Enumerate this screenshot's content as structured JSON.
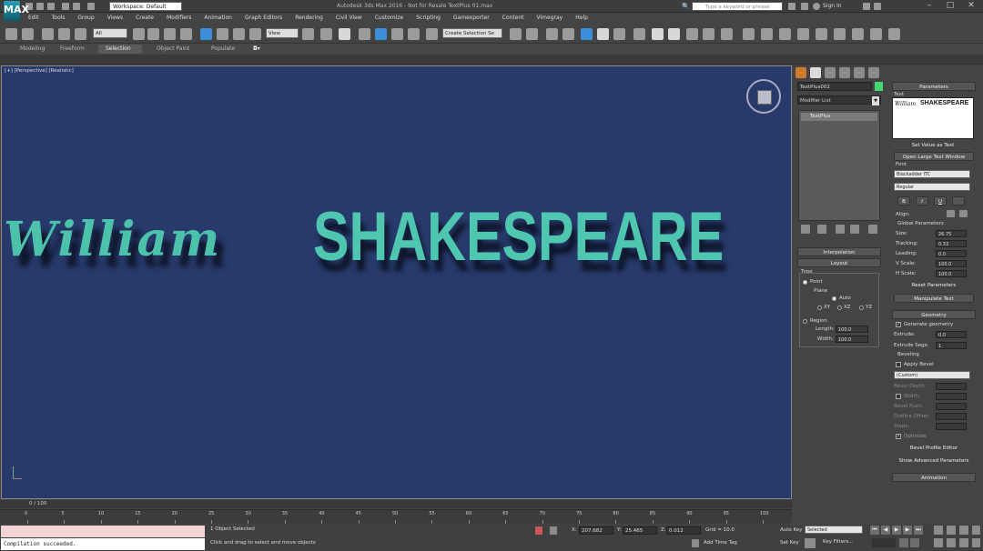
{
  "app": {
    "logo": "MAX",
    "workspace": "Workspace: Default",
    "window_title": "Autodesk 3ds Max 2016 - Not for Resale   TextPlus 01.max",
    "search_placeholder": "Type a keyword or phrase",
    "sign_in": "Sign In"
  },
  "menu": [
    "Edit",
    "Tools",
    "Group",
    "Views",
    "Create",
    "Modifiers",
    "Animation",
    "Graph Editors",
    "Rendering",
    "Civil View",
    "Customize",
    "Scripting",
    "Gamexporter",
    "Content",
    "Vimegray",
    "Help"
  ],
  "toolbar": {
    "filter": "All",
    "ref_coord": "View",
    "selection_set": "Create Selection Se"
  },
  "ribbon": {
    "tabs": [
      "Modeling",
      "Freeform",
      "Selection",
      "Object Paint",
      "Populate"
    ],
    "active": "Selection"
  },
  "viewport": {
    "label": "[+] [Perspective] [Realistic]",
    "text_script": "William",
    "text_bold": "SHAKESPEARE",
    "text_color": "#4fc6b0"
  },
  "command_panel": {
    "object_name": "TextPlus002",
    "object_color": "#44d96f",
    "modifier_list": "Modifier List",
    "stack_item": "TextPlus",
    "interpolation": "Interpolation",
    "layout": {
      "title": "Layout",
      "type_label": "Type",
      "point": "Point",
      "plane_label": "Plane",
      "auto": "Auto",
      "xy": "XY",
      "xz": "XZ",
      "yz": "YZ",
      "region": "Region",
      "length_label": "Length:",
      "length": "100.0",
      "width_label": "Width:",
      "width": "100.0"
    }
  },
  "parameters": {
    "title": "Parameters",
    "text_label": "Text",
    "text_preview_script": "William",
    "text_preview_bold": "SHAKESPEARE",
    "set_value_btn": "Set Value as Text",
    "open_large_btn": "Open Large Text Window",
    "font_label": "Font",
    "font_family": "Blackadder ITC",
    "font_style": "Regular",
    "bold_btn": "B",
    "italic_btn": "I",
    "underline_btn": "U",
    "align_label": "Align:",
    "global_params": "Global Parameters",
    "size_label": "Size:",
    "size": "26.75",
    "tracking_label": "Tracking:",
    "tracking": "0.33",
    "leading_label": "Leading:",
    "leading": "0.0",
    "vscale_label": "V Scale:",
    "vscale": "100.0",
    "hscale_label": "H Scale:",
    "hscale": "100.0",
    "reset_btn": "Reset Parameters",
    "manipulate_btn": "Manipulate Text"
  },
  "geometry": {
    "title": "Geometry",
    "generate": "Generate geometry",
    "extrude_label": "Extrude:",
    "extrude": "0.0",
    "extrude_segs_label": "Extrude Segs:",
    "extrude_segs": "1",
    "beveling": "Beveling",
    "apply_bevel": "Apply Bevel",
    "preset": "(Custom)",
    "bevel_depth": "Bevel Depth:",
    "width": "Width:",
    "bevel_push": "Bevel Push:",
    "outline_offset": "Outline Offset:",
    "steps": "Steps:",
    "optimize": "Optimize",
    "profile_btn": "Bevel Profile Editor",
    "advanced_btn": "Show Advanced Parameters",
    "animation": "Animation"
  },
  "timeline": {
    "slider": "0 / 100",
    "ticks": [
      "0",
      "5",
      "10",
      "15",
      "20",
      "25",
      "30",
      "35",
      "40",
      "45",
      "50",
      "55",
      "60",
      "65",
      "70",
      "75",
      "80",
      "85",
      "90",
      "95",
      "100"
    ]
  },
  "status": {
    "maxscript_out": "",
    "maxscript_in": "Compilation succeeded.",
    "selection": "1 Object Selected",
    "prompt": "Click and drag to select and move objects",
    "x_label": "X:",
    "x": "207.682",
    "y_label": "Y:",
    "y": "25.465",
    "z_label": "Z:",
    "z": "0.012",
    "grid": "Grid = 10.0",
    "add_time_tag": "Add Time Tag",
    "auto_key": "Auto Key",
    "selected": "Selected",
    "set_key": "Set Key",
    "key_filters": "Key Filters..."
  }
}
